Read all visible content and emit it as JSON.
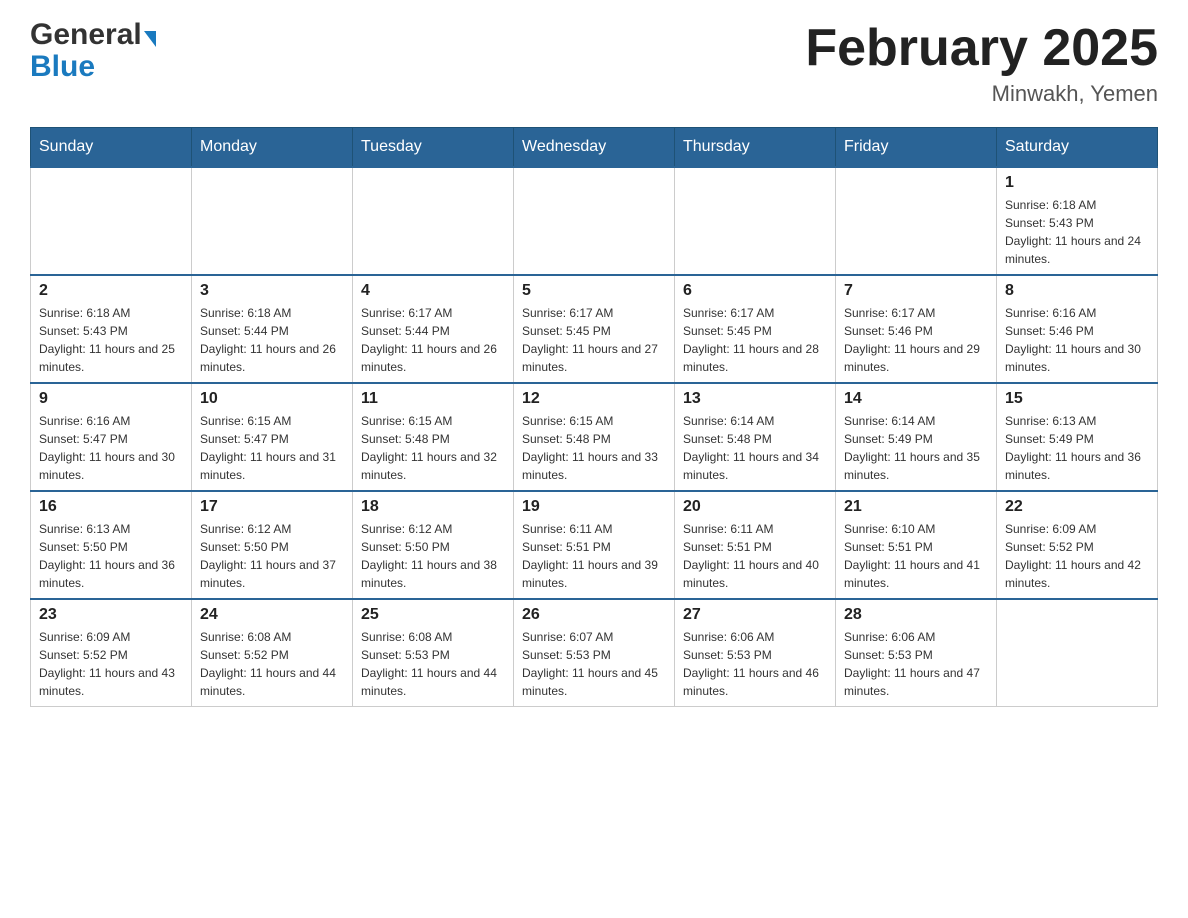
{
  "header": {
    "logo": {
      "general": "General",
      "blue": "Blue"
    },
    "title": "February 2025",
    "location": "Minwakh, Yemen"
  },
  "days_of_week": [
    "Sunday",
    "Monday",
    "Tuesday",
    "Wednesday",
    "Thursday",
    "Friday",
    "Saturday"
  ],
  "weeks": [
    [
      {
        "day": "",
        "info": ""
      },
      {
        "day": "",
        "info": ""
      },
      {
        "day": "",
        "info": ""
      },
      {
        "day": "",
        "info": ""
      },
      {
        "day": "",
        "info": ""
      },
      {
        "day": "",
        "info": ""
      },
      {
        "day": "1",
        "info": "Sunrise: 6:18 AM\nSunset: 5:43 PM\nDaylight: 11 hours and 24 minutes."
      }
    ],
    [
      {
        "day": "2",
        "info": "Sunrise: 6:18 AM\nSunset: 5:43 PM\nDaylight: 11 hours and 25 minutes."
      },
      {
        "day": "3",
        "info": "Sunrise: 6:18 AM\nSunset: 5:44 PM\nDaylight: 11 hours and 26 minutes."
      },
      {
        "day": "4",
        "info": "Sunrise: 6:17 AM\nSunset: 5:44 PM\nDaylight: 11 hours and 26 minutes."
      },
      {
        "day": "5",
        "info": "Sunrise: 6:17 AM\nSunset: 5:45 PM\nDaylight: 11 hours and 27 minutes."
      },
      {
        "day": "6",
        "info": "Sunrise: 6:17 AM\nSunset: 5:45 PM\nDaylight: 11 hours and 28 minutes."
      },
      {
        "day": "7",
        "info": "Sunrise: 6:17 AM\nSunset: 5:46 PM\nDaylight: 11 hours and 29 minutes."
      },
      {
        "day": "8",
        "info": "Sunrise: 6:16 AM\nSunset: 5:46 PM\nDaylight: 11 hours and 30 minutes."
      }
    ],
    [
      {
        "day": "9",
        "info": "Sunrise: 6:16 AM\nSunset: 5:47 PM\nDaylight: 11 hours and 30 minutes."
      },
      {
        "day": "10",
        "info": "Sunrise: 6:15 AM\nSunset: 5:47 PM\nDaylight: 11 hours and 31 minutes."
      },
      {
        "day": "11",
        "info": "Sunrise: 6:15 AM\nSunset: 5:48 PM\nDaylight: 11 hours and 32 minutes."
      },
      {
        "day": "12",
        "info": "Sunrise: 6:15 AM\nSunset: 5:48 PM\nDaylight: 11 hours and 33 minutes."
      },
      {
        "day": "13",
        "info": "Sunrise: 6:14 AM\nSunset: 5:48 PM\nDaylight: 11 hours and 34 minutes."
      },
      {
        "day": "14",
        "info": "Sunrise: 6:14 AM\nSunset: 5:49 PM\nDaylight: 11 hours and 35 minutes."
      },
      {
        "day": "15",
        "info": "Sunrise: 6:13 AM\nSunset: 5:49 PM\nDaylight: 11 hours and 36 minutes."
      }
    ],
    [
      {
        "day": "16",
        "info": "Sunrise: 6:13 AM\nSunset: 5:50 PM\nDaylight: 11 hours and 36 minutes."
      },
      {
        "day": "17",
        "info": "Sunrise: 6:12 AM\nSunset: 5:50 PM\nDaylight: 11 hours and 37 minutes."
      },
      {
        "day": "18",
        "info": "Sunrise: 6:12 AM\nSunset: 5:50 PM\nDaylight: 11 hours and 38 minutes."
      },
      {
        "day": "19",
        "info": "Sunrise: 6:11 AM\nSunset: 5:51 PM\nDaylight: 11 hours and 39 minutes."
      },
      {
        "day": "20",
        "info": "Sunrise: 6:11 AM\nSunset: 5:51 PM\nDaylight: 11 hours and 40 minutes."
      },
      {
        "day": "21",
        "info": "Sunrise: 6:10 AM\nSunset: 5:51 PM\nDaylight: 11 hours and 41 minutes."
      },
      {
        "day": "22",
        "info": "Sunrise: 6:09 AM\nSunset: 5:52 PM\nDaylight: 11 hours and 42 minutes."
      }
    ],
    [
      {
        "day": "23",
        "info": "Sunrise: 6:09 AM\nSunset: 5:52 PM\nDaylight: 11 hours and 43 minutes."
      },
      {
        "day": "24",
        "info": "Sunrise: 6:08 AM\nSunset: 5:52 PM\nDaylight: 11 hours and 44 minutes."
      },
      {
        "day": "25",
        "info": "Sunrise: 6:08 AM\nSunset: 5:53 PM\nDaylight: 11 hours and 44 minutes."
      },
      {
        "day": "26",
        "info": "Sunrise: 6:07 AM\nSunset: 5:53 PM\nDaylight: 11 hours and 45 minutes."
      },
      {
        "day": "27",
        "info": "Sunrise: 6:06 AM\nSunset: 5:53 PM\nDaylight: 11 hours and 46 minutes."
      },
      {
        "day": "28",
        "info": "Sunrise: 6:06 AM\nSunset: 5:53 PM\nDaylight: 11 hours and 47 minutes."
      },
      {
        "day": "",
        "info": ""
      }
    ]
  ]
}
